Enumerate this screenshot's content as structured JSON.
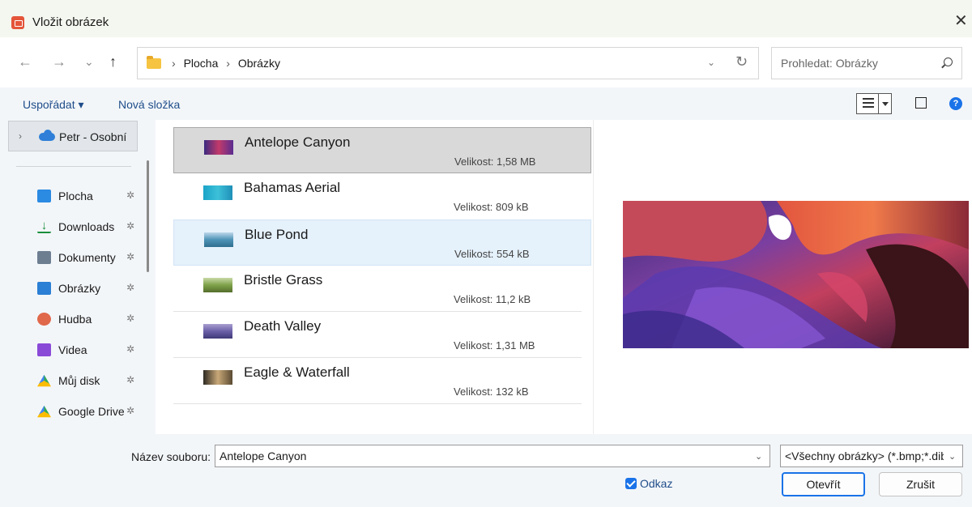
{
  "window": {
    "title": "Vložit obrázek",
    "close_glyph": "✕"
  },
  "nav": {
    "back": "←",
    "forward": "→",
    "recent": "⌄",
    "up": "↑",
    "refresh": "↻",
    "chevron": "⌄"
  },
  "breadcrumb": {
    "sep": "›",
    "items": [
      "Plocha",
      "Obrázky"
    ]
  },
  "search": {
    "placeholder": "Prohledat: Obrázky"
  },
  "toolbar": {
    "organize": "Uspořádat ▾",
    "new_folder": "Nová složka",
    "help": "?"
  },
  "sidebar": {
    "onedrive": {
      "chevron": "›",
      "label": "Petr - Osobní"
    },
    "items": [
      {
        "label": "Plocha",
        "icon": "desktop-icon",
        "color": "#2b8ae2"
      },
      {
        "label": "Downloads",
        "icon": "download-icon",
        "color": "#1a8f3c"
      },
      {
        "label": "Dokumenty",
        "icon": "document-icon",
        "color": "#6d7e91"
      },
      {
        "label": "Obrázky",
        "icon": "pictures-icon",
        "color": "#2b7fd4"
      },
      {
        "label": "Hudba",
        "icon": "music-icon",
        "color": "#e0684b"
      },
      {
        "label": "Videa",
        "icon": "video-icon",
        "color": "#8a4ad8"
      },
      {
        "label": "Můj disk",
        "icon": "google-drive-icon",
        "color": "#34a853"
      },
      {
        "label": "Google Drive",
        "icon": "google-drive-icon",
        "color": "#fbbc04"
      }
    ],
    "pin": "✲"
  },
  "files": [
    {
      "name": "Antelope Canyon",
      "size": "Velikost: 1,58 MB",
      "thumb": "linear-gradient(90deg,#3b2a80,#c23a6a,#5a2c90)"
    },
    {
      "name": "Bahamas Aerial",
      "size": "Velikost: 809 kB",
      "thumb": "linear-gradient(90deg,#1ba4c8,#3cc0d8,#1f8fb8)"
    },
    {
      "name": "Blue Pond",
      "size": "Velikost: 554 kB",
      "thumb": "linear-gradient(180deg,#bcd7ea,#4d93b6,#2f6f8f)"
    },
    {
      "name": "Bristle Grass",
      "size": "Velikost: 11,2 kB",
      "thumb": "linear-gradient(180deg,#c9d9a6,#7ea24a,#556e2c)"
    },
    {
      "name": "Death Valley",
      "size": "Velikost: 1,31 MB",
      "thumb": "linear-gradient(180deg,#a99fd0,#6a5fa8,#3f3a78)"
    },
    {
      "name": "Eagle & Waterfall",
      "size": "Velikost: 132 kB",
      "thumb": "linear-gradient(90deg,#2e2a22,#c8a878,#5a4a32)"
    }
  ],
  "bottom": {
    "filename_label": "Název souboru:",
    "filename_value": "Antelope Canyon",
    "filter_value": "<Všechny obrázky> (*.bmp;*.dib;*.jpg)",
    "link_label": "Odkaz",
    "open_label": "Otevřít",
    "cancel_label": "Zrušit",
    "chevron": "⌄"
  },
  "colors": {
    "accent": "#1a73e8",
    "link": "#1f4d8a",
    "selected_row": "#d9d9d9",
    "hover_row": "#e5f1fb"
  }
}
